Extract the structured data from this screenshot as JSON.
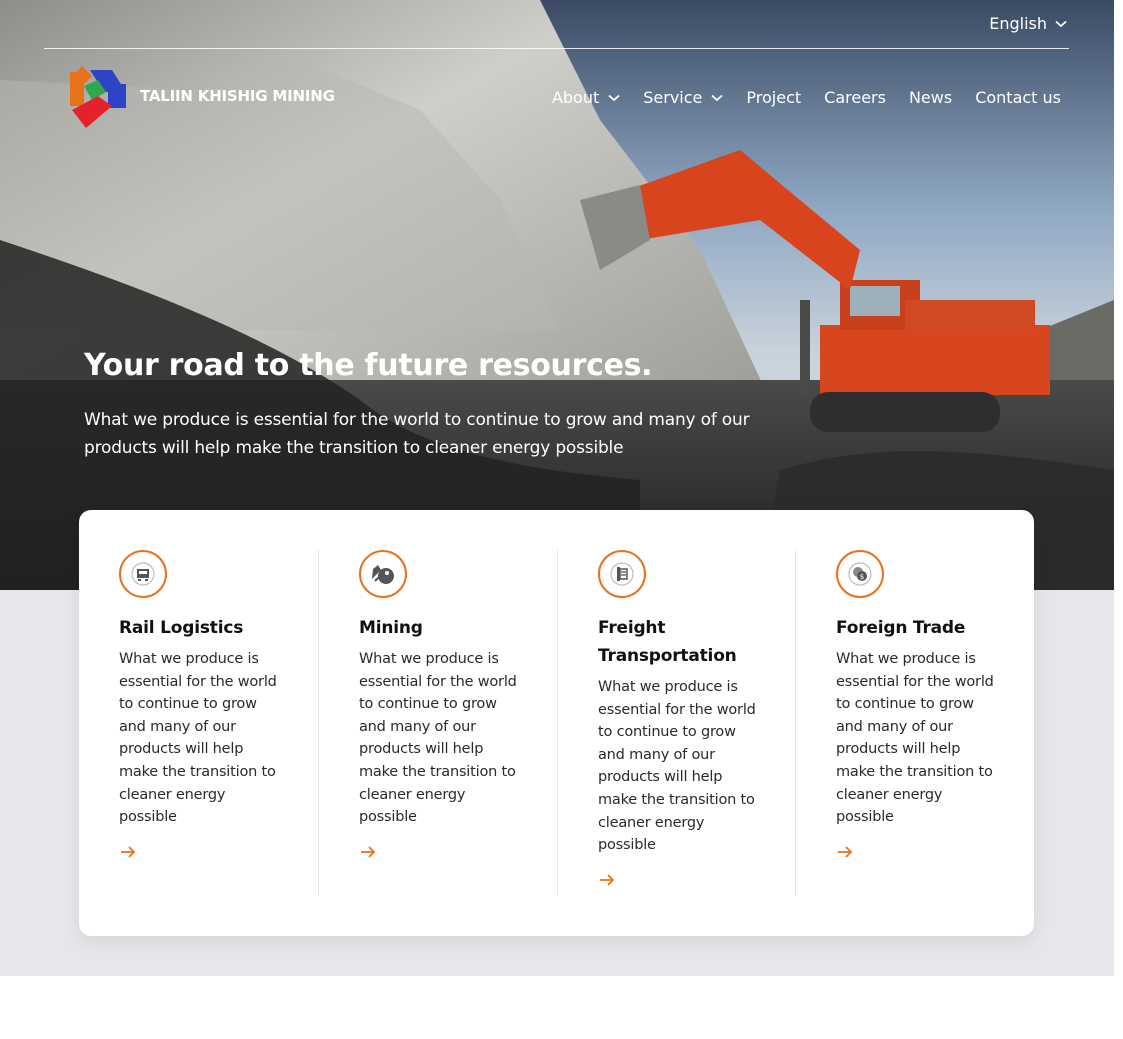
{
  "header": {
    "language": "English",
    "logo_text": "TALIIN KHISHIG MINING",
    "nav": [
      {
        "label": "About",
        "has_dropdown": true
      },
      {
        "label": "Service",
        "has_dropdown": true
      },
      {
        "label": "Project",
        "has_dropdown": false
      },
      {
        "label": "Careers",
        "has_dropdown": false
      },
      {
        "label": "News",
        "has_dropdown": false
      },
      {
        "label": "Contact us",
        "has_dropdown": false
      }
    ]
  },
  "hero": {
    "title": "Your road to the future resources.",
    "subtitle": "What we produce is essential for the world to continue to grow and many of our products will help make the transition to cleaner energy possible"
  },
  "services": [
    {
      "title": "Rail Logistics",
      "text": "What we produce is essential for the world to continue to grow and many of our products will help make the transition to cleaner energy possible",
      "icon": "rail-logistics-icon"
    },
    {
      "title": "Mining",
      "text": "What we produce is essential for the world to continue to grow and many of our products will help make the transition to cleaner energy possible",
      "icon": "mining-icon"
    },
    {
      "title": "Freight Transportation",
      "text": "What we produce is essential for the world to continue to grow and many of our products will help make the transition to cleaner energy possible",
      "icon": "freight-icon"
    },
    {
      "title": "Foreign Trade",
      "text": "What we produce is essential for the world to continue to grow and many of our products will help make the transition to cleaner energy possible",
      "icon": "foreign-trade-icon"
    }
  ],
  "colors": {
    "accent": "#e8721c",
    "panel_bg": "#e5e7ea"
  }
}
